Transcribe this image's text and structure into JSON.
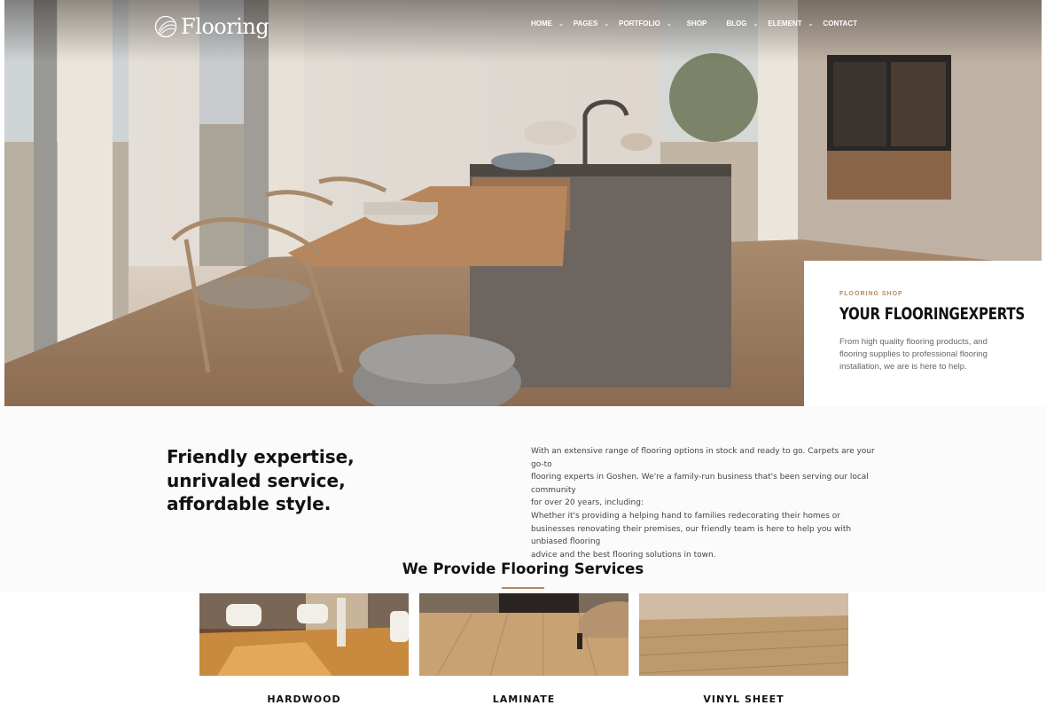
{
  "brand": {
    "name": "Flooring",
    "logo_icon": "leaf-circle-icon"
  },
  "nav": {
    "items": [
      {
        "label": "HOME",
        "has_dropdown": true
      },
      {
        "label": "PAGES",
        "has_dropdown": true
      },
      {
        "label": "PORTFOLIO",
        "has_dropdown": true
      },
      {
        "label": "SHOP",
        "has_dropdown": false
      },
      {
        "label": "BLOG",
        "has_dropdown": true
      },
      {
        "label": "ELEMENT",
        "has_dropdown": true
      },
      {
        "label": "CONTACT",
        "has_dropdown": false
      }
    ]
  },
  "hero_card": {
    "eyebrow": "FLOORING SHOP",
    "title": "YOUR FLOORINGEXPERTS",
    "text": "From high quality flooring products, and flooring supplies to professional flooring installation, we are is here to help."
  },
  "intro": {
    "heading_lines": [
      "Friendly expertise,",
      "unrivaled service,",
      "affordable style."
    ],
    "body_lines": [
      "With an extensive range of flooring options in stock and ready to go. Carpets are your go-to",
      "flooring experts in Goshen. We're a family-run business that's been serving our local community",
      "for over 20 years, including:",
      "Whether it's providing a helping hand to families redecorating their homes or",
      "businesses renovating their premises, our friendly team is here to help you with unbiased flooring",
      "advice and the best flooring solutions in town."
    ]
  },
  "services": {
    "title": "We Provide Flooring Services",
    "items": [
      {
        "label": "HARDWOOD"
      },
      {
        "label": "LAMINATE"
      },
      {
        "label": "VINYL SHEET"
      }
    ]
  },
  "colors": {
    "accent": "#b58a5c",
    "heading": "#111111",
    "body": "#444444"
  }
}
